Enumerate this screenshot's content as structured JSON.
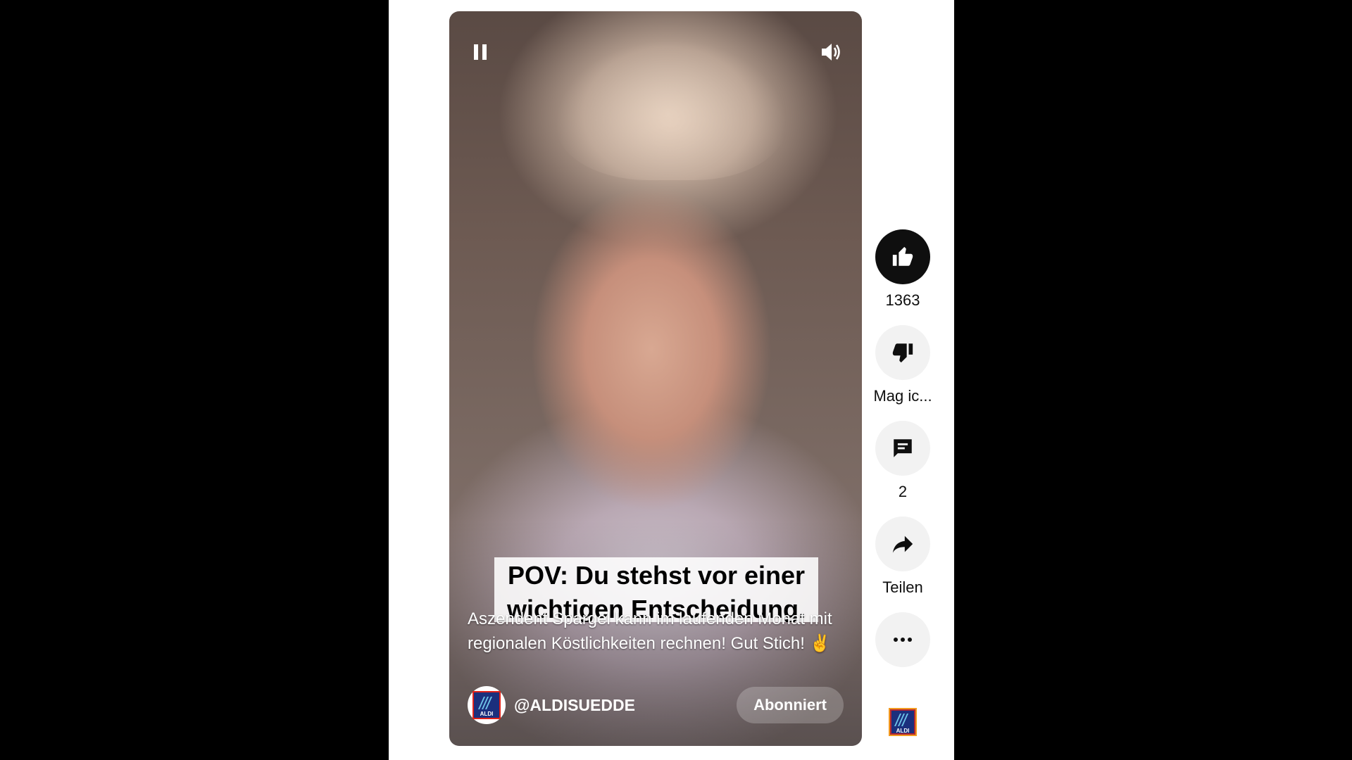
{
  "player": {
    "caption_line1": "POV: Du stehst vor einer",
    "caption_line2": "wichtigen Entscheidung.",
    "description": "Aszendent Spargel kann im laufenden Monat mit regionalen Köstlichkeiten rechnen! Gut Stich! ✌️",
    "channel_handle": "@ALDISUEDDE",
    "subscribe_label": "Abonniert",
    "logo_text": "ALDI"
  },
  "actions": {
    "like_count": "1363",
    "dislike_label": "Mag ic...",
    "comments_count": "2",
    "share_label": "Teilen"
  },
  "colors": {
    "aldi_blue": "#1b2f7d",
    "aldi_orange": "#f39a1f",
    "aldi_red": "#e2231a"
  }
}
